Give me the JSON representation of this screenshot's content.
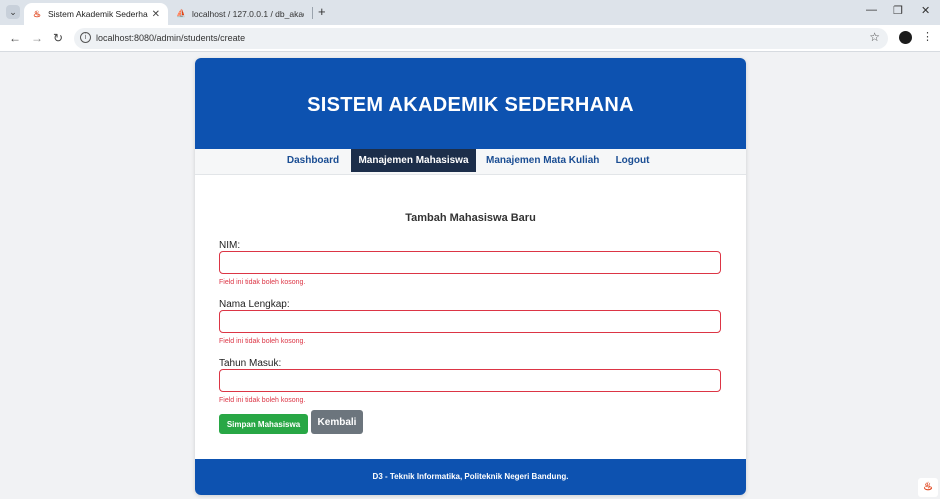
{
  "browser": {
    "tabs": [
      {
        "title": "Sistem Akademik Sederhana",
        "favicon": "codeigniter-flame-icon",
        "close": "✕"
      },
      {
        "title": "localhost / 127.0.0.1 / db_akade",
        "favicon": "phpmyadmin-sail-icon",
        "close": ""
      }
    ],
    "new_tab": "+",
    "url": "localhost:8080/admin/students/create",
    "window_controls": {
      "minimize": "—",
      "restore": "❐",
      "close": "✕"
    }
  },
  "header": {
    "title": "SISTEM AKADEMIK SEDERHANA"
  },
  "nav": {
    "items": [
      {
        "label": "Dashboard",
        "active": false
      },
      {
        "label": "Manajemen Mahasiswa",
        "active": true
      },
      {
        "label": "Manajemen Mata Kuliah",
        "active": false
      },
      {
        "label": "Logout",
        "active": false
      }
    ]
  },
  "form": {
    "title": "Tambah Mahasiswa Baru",
    "fields": [
      {
        "label": "NIM:",
        "value": "",
        "error": "Field ini tidak boleh kosong."
      },
      {
        "label": "Nama Lengkap:",
        "value": "",
        "error": "Field ini tidak boleh kosong."
      },
      {
        "label": "Tahun Masuk:",
        "value": "",
        "error": "Field ini tidak boleh kosong."
      }
    ],
    "submit_label": "Simpan Mahasiswa",
    "back_label": "Kembali"
  },
  "footer": {
    "text": "D3 - Teknik Informatika, Politeknik Negeri Bandung."
  },
  "colors": {
    "brand_blue": "#0d52b0",
    "nav_active": "#1c2e4a",
    "error_red": "#dc3545",
    "success_green": "#28a745",
    "secondary_gray": "#6c757d"
  }
}
